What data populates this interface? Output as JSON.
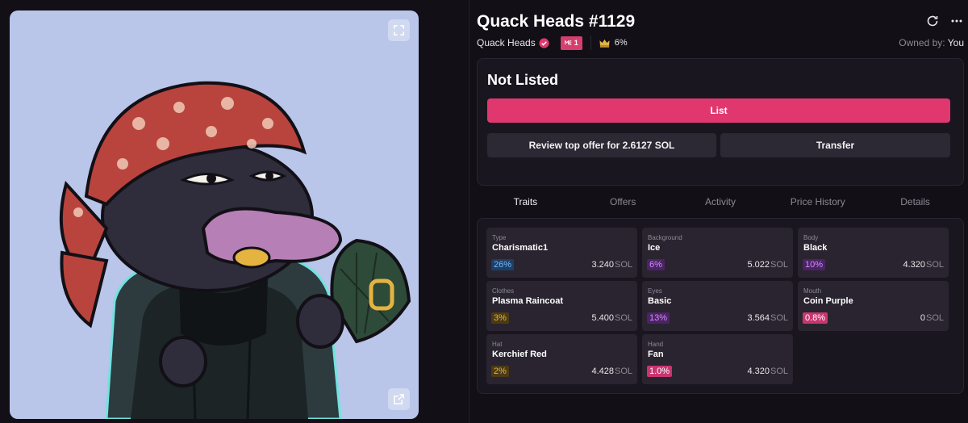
{
  "nft": {
    "title": "Quack Heads #1129",
    "collection": "Quack Heads",
    "me_badge": "1",
    "rarity_rank": "6%",
    "owned_by_label": "Owned by:",
    "owner": "You"
  },
  "listing": {
    "status": "Not Listed",
    "list_label": "List",
    "offer_label": "Review top offer for 2.6127 SOL",
    "transfer_label": "Transfer"
  },
  "tabs": [
    {
      "label": "Traits",
      "active": true
    },
    {
      "label": "Offers",
      "active": false
    },
    {
      "label": "Activity",
      "active": false
    },
    {
      "label": "Price History",
      "active": false
    },
    {
      "label": "Details",
      "active": false
    }
  ],
  "traits": [
    {
      "type": "Type",
      "value": "Charismatic1",
      "pct": "26%",
      "price": "3.240",
      "unit": "SOL",
      "color": "blue"
    },
    {
      "type": "Background",
      "value": "Ice",
      "pct": "6%",
      "price": "5.022",
      "unit": "SOL",
      "color": "purple"
    },
    {
      "type": "Body",
      "value": "Black",
      "pct": "10%",
      "price": "4.320",
      "unit": "SOL",
      "color": "purple"
    },
    {
      "type": "Clothes",
      "value": "Plasma Raincoat",
      "pct": "3%",
      "price": "5.400",
      "unit": "SOL",
      "color": "gold"
    },
    {
      "type": "Eyes",
      "value": "Basic",
      "pct": "13%",
      "price": "3.564",
      "unit": "SOL",
      "color": "purple"
    },
    {
      "type": "Mouth",
      "value": "Coin Purple",
      "pct": "0.8%",
      "price": "0",
      "unit": "SOL",
      "color": "pink"
    },
    {
      "type": "Hat",
      "value": "Kerchief Red",
      "pct": "2%",
      "price": "4.428",
      "unit": "SOL",
      "color": "gold"
    },
    {
      "type": "Hand",
      "value": "Fan",
      "pct": "1.0%",
      "price": "4.320",
      "unit": "SOL",
      "color": "pink"
    }
  ],
  "colors": {
    "accent": "#e0386e",
    "background": "#120f17",
    "panel": "#1a1620",
    "nft_background": "#b9c5e9"
  },
  "icons": [
    "expand-icon",
    "external-link-icon",
    "refresh-icon",
    "more-icon",
    "verified-icon",
    "crown-icon"
  ]
}
